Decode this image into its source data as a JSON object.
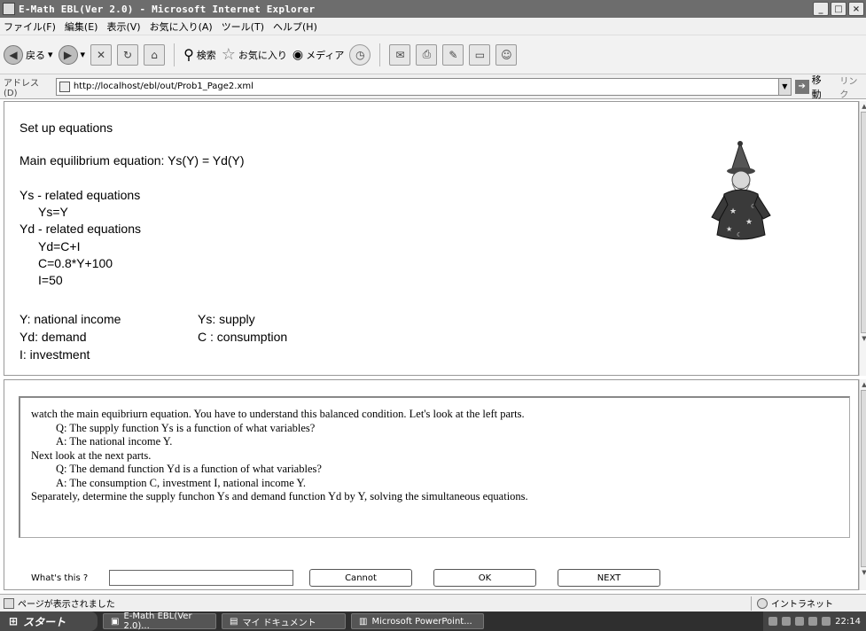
{
  "window": {
    "title": "E-Math EBL(Ver 2.0) - Microsoft Internet Explorer",
    "controls": [
      "_",
      "□",
      "×"
    ]
  },
  "menu": [
    "ファイル(F)",
    "編集(E)",
    "表示(V)",
    "お気に入り(A)",
    "ツール(T)",
    "ヘルプ(H)"
  ],
  "toolbar": {
    "back": "戻る",
    "search": "検索",
    "favorites": "お気に入り",
    "media": "メディア"
  },
  "address": {
    "label": "アドレス(D)",
    "url": "http://localhost/ebl/out/Prob1_Page2.xml",
    "go": "移動",
    "links": "リンク"
  },
  "problem": {
    "heading": "Set up equations",
    "main_eq": "Main equilibrium equation: Ys(Y) = Yd(Y)",
    "ys_header": "Ys - related equations",
    "ys_eq1": "Ys=Y",
    "yd_header": "Yd - related equations",
    "yd_eq1": "Yd=C+I",
    "yd_eq2": "C=0.8*Y+100",
    "yd_eq3": "I=50",
    "def_y": "Y: national income",
    "def_ys": "Ys: supply",
    "def_yd": "Yd: demand",
    "def_c": "C : consumption",
    "def_i": "I: investment"
  },
  "explanation": {
    "line1": "watch the main equibriurn equation. You have to understand this balanced condition. Let's look at the left parts.",
    "line2": "Q: The supply function Ys is a function of what variables?",
    "line3": "A: The national income Y.",
    "line4": "Next look at the next parts.",
    "line5": "Q: The demand function Yd is a function of what variables?",
    "line6": "A: The consumption C, investment I, national income Y.",
    "line7": "Separately, determine the supply funchon Ys and demand function Yd by Y, solving the simultaneous equations."
  },
  "controls": {
    "whats_label": "What's this ?",
    "whats_value": "",
    "cannot": "Cannot",
    "ok": "OK",
    "next": "NEXT"
  },
  "status": {
    "left": "ページが表示されました",
    "zone": "イントラネット"
  },
  "taskbar": {
    "start": "スタート",
    "tasks": [
      "E-Math EBL(Ver 2.0)...",
      "マイ ドキュメント",
      "Microsoft PowerPoint..."
    ],
    "clock": "22:14"
  }
}
